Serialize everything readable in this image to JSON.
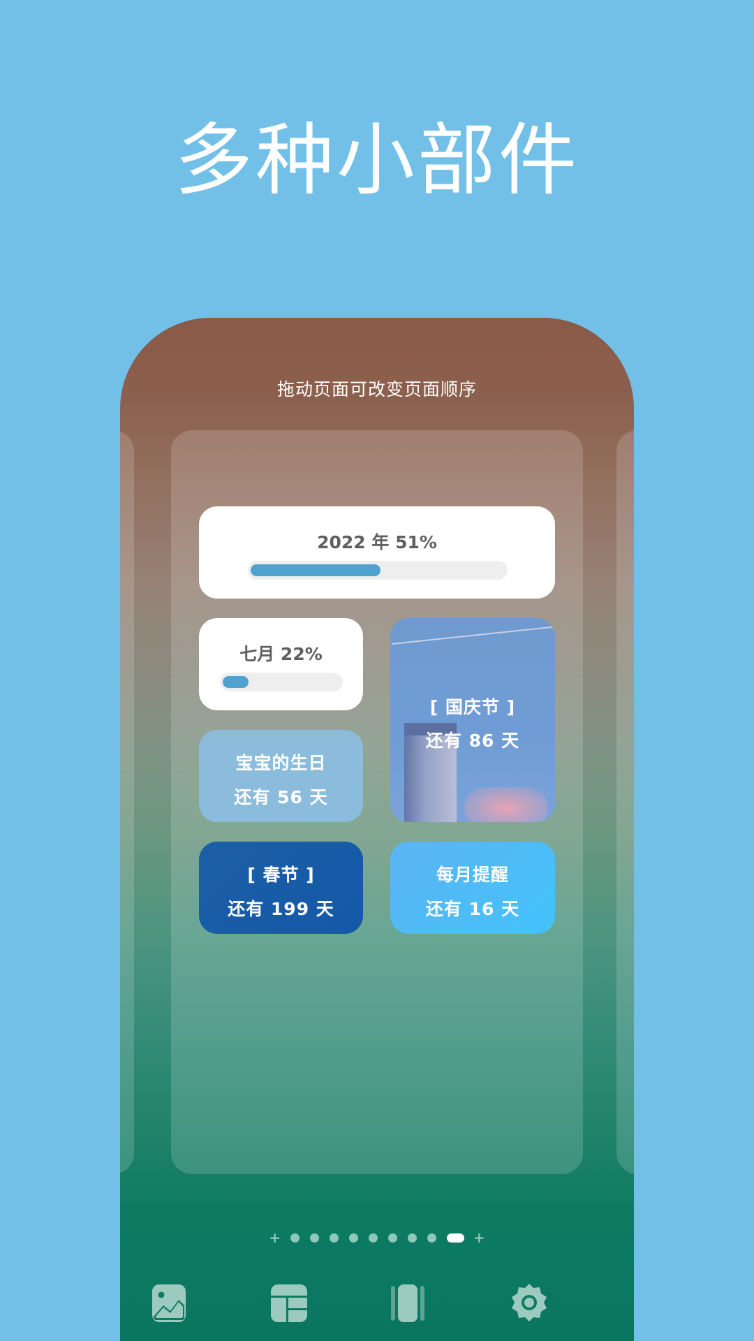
{
  "headline": "多种小部件",
  "phone": {
    "hint": "拖动页面可改变页面顺序",
    "widgets": {
      "year_progress": {
        "label": "2022 年 51%",
        "progress": 0.51
      },
      "month_progress": {
        "label": "七月 22%",
        "progress": 0.22
      },
      "baby_birthday": {
        "title": "宝宝的生日",
        "countdown": "还有 56 天"
      },
      "national_day": {
        "title": "[ 国庆节 ]",
        "countdown": "还有 86 天"
      },
      "spring_festival": {
        "title": "[ 春节 ]",
        "countdown": "还有 199 天"
      },
      "monthly_reminder": {
        "title": "每月提醒",
        "countdown": "还有 16 天"
      }
    },
    "pager": {
      "leading_icon": "add-page-icon",
      "page_count": 9,
      "active_index": 8,
      "trailing_icon": "add-page-icon"
    },
    "bottom_nav": [
      {
        "icon": "image-icon",
        "label": "wallpaper"
      },
      {
        "icon": "layout-icon",
        "label": "widgets"
      },
      {
        "icon": "pages-icon",
        "label": "pages"
      },
      {
        "icon": "gear-icon",
        "label": "settings"
      }
    ]
  },
  "colors": {
    "background": "#72c0e8",
    "progress_fill": "#4fa1ce",
    "progress_track": "#eeeeee",
    "widget_text_dark": "#5f5f5f",
    "icon_tint": "#8fc7b9"
  }
}
